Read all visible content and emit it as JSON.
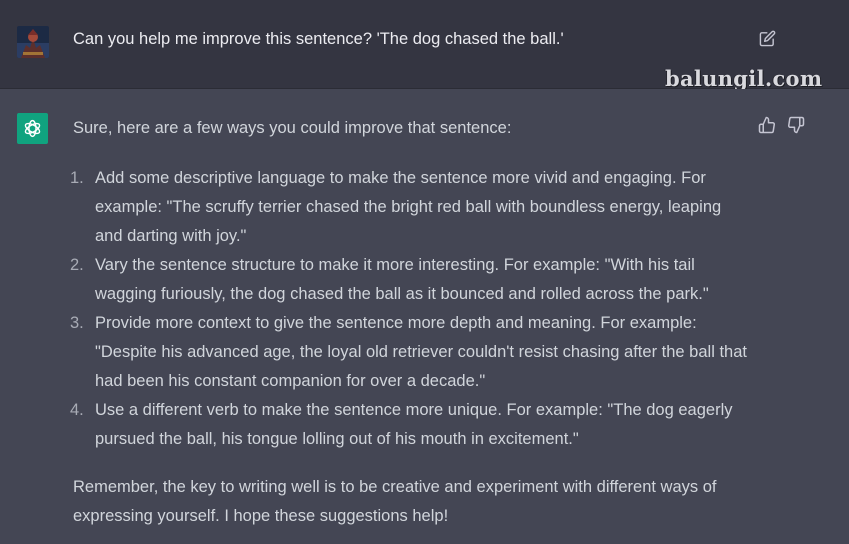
{
  "user": {
    "message": "Can you help me improve this sentence? 'The dog chased the ball.'"
  },
  "watermark": "balungil.com",
  "assistant": {
    "intro": "Sure, here are a few ways you could improve that sentence:",
    "items": [
      {
        "number": "1.",
        "text": "Add some descriptive language to make the sentence more vivid and engaging. For example: \"The scruffy terrier chased the bright red ball with boundless energy, leaping and darting with joy.\""
      },
      {
        "number": "2.",
        "text": "Vary the sentence structure to make it more interesting. For example: \"With his tail wagging furiously, the dog chased the ball as it bounced and rolled across the park.\""
      },
      {
        "number": "3.",
        "text": "Provide more context to give the sentence more depth and meaning. For example: \"Despite his advanced age, the loyal old retriever couldn't resist chasing after the ball that had been his constant companion for over a decade.\""
      },
      {
        "number": "4.",
        "text": "Use a different verb to make the sentence more unique. For example: \"The dog eagerly pursued the ball, his tongue lolling out of his mouth in excitement.\""
      }
    ],
    "outro": "Remember, the key to writing well is to be creative and experiment with different ways of expressing yourself. I hope these suggestions help!"
  },
  "icons": {
    "edit": "edit-icon",
    "thumbs_up": "thumbs-up-icon",
    "thumbs_down": "thumbs-down-icon",
    "assistant_logo": "openai-logo-icon"
  },
  "colors": {
    "user_bg": "#343541",
    "assistant_bg": "#444654",
    "accent": "#10a37f",
    "text": "#d1d5db"
  }
}
